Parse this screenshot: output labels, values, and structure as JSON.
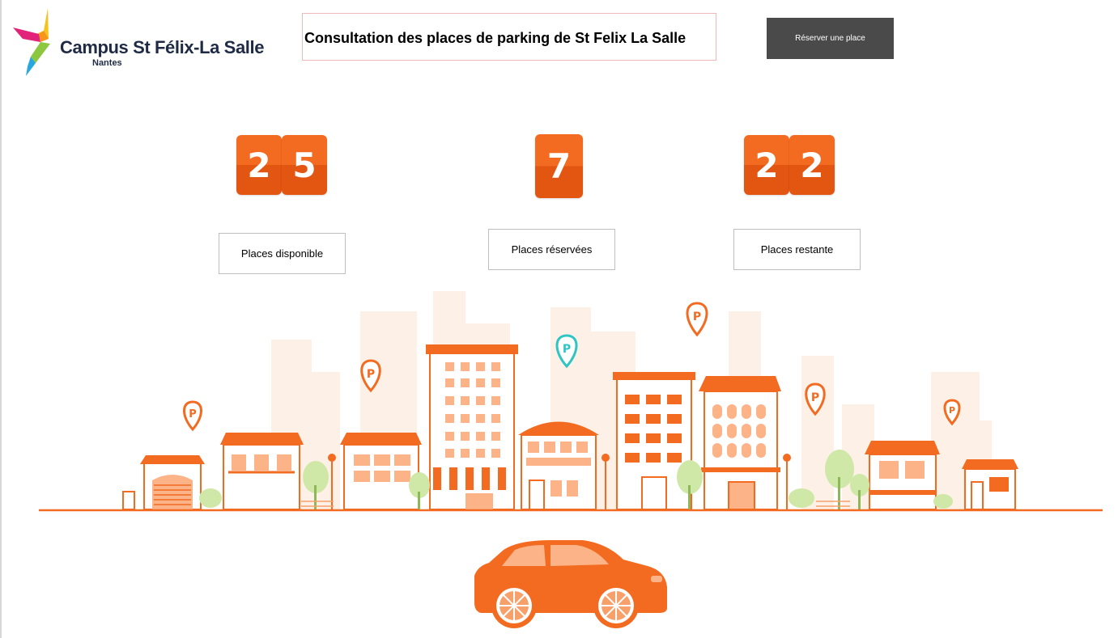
{
  "logo": {
    "name": "Campus St Félix-La Salle",
    "city": "Nantes"
  },
  "title": "Consultation des places de parking de St Felix La Salle",
  "reserve_button": "Réserver une place",
  "counters": {
    "disponible": {
      "digits": [
        "2",
        "5"
      ],
      "label": "Places disponible"
    },
    "reservees": {
      "digits": [
        "7"
      ],
      "label": "Places réservées"
    },
    "restante": {
      "digits": [
        "2",
        "2"
      ],
      "label": "Places restante"
    }
  },
  "illustration": {
    "pins": [
      "parking-pin",
      "parking-pin",
      "parking-pin",
      "parking-pin",
      "parking-pin",
      "parking-pin"
    ],
    "pin_letter": "P"
  },
  "colors": {
    "orange": "#f26b21",
    "orange_dark": "#e35612",
    "building_fill": "#fde7d8",
    "teal": "#2ec5c4",
    "green": "#b7de8c"
  }
}
